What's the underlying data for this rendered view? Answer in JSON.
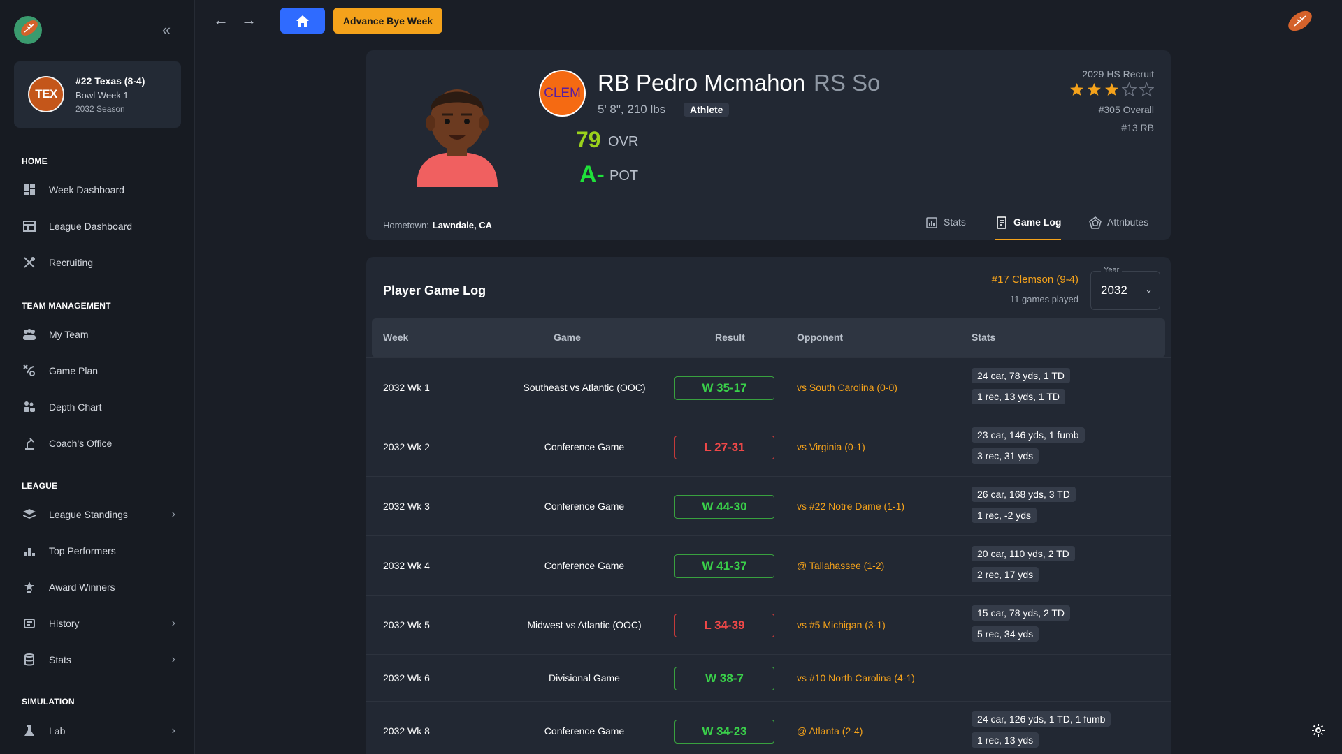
{
  "sidebar": {
    "team_card": {
      "badge": "TEX",
      "title": "#22 Texas (8-4)",
      "week": "Bowl Week 1",
      "season": "2032 Season"
    },
    "sections": {
      "home": "HOME",
      "team_management": "TEAM MANAGEMENT",
      "league": "LEAGUE",
      "simulation": "SIMULATION"
    },
    "items": [
      {
        "label": "Week Dashboard",
        "icon": "dashboard-icon"
      },
      {
        "label": "League Dashboard",
        "icon": "table-icon"
      },
      {
        "label": "Recruiting",
        "icon": "recruiting-icon"
      },
      {
        "label": "My Team",
        "icon": "team-icon"
      },
      {
        "label": "Game Plan",
        "icon": "game-plan-icon"
      },
      {
        "label": "Depth Chart",
        "icon": "depth-chart-icon"
      },
      {
        "label": "Coach's Office",
        "icon": "desk-lamp-icon"
      },
      {
        "label": "League Standings",
        "icon": "layers-icon"
      },
      {
        "label": "Top Performers",
        "icon": "podium-icon"
      },
      {
        "label": "Award Winners",
        "icon": "trophy-icon"
      },
      {
        "label": "History",
        "icon": "history-icon"
      },
      {
        "label": "Stats",
        "icon": "database-icon"
      },
      {
        "label": "Lab",
        "icon": "flask-icon"
      }
    ]
  },
  "topbar": {
    "advance_label": "Advance Bye Week"
  },
  "player": {
    "team_badge": "CLEM",
    "name": "RB Pedro Mcmahon",
    "class_year": "RS So",
    "body": "5' 8\", 210 lbs",
    "tag": "Athlete",
    "ovr": "79",
    "ovr_label": "OVR",
    "pot": "A-",
    "pot_label": "POT",
    "recruit_year": "2029 HS Recruit",
    "stars": 3,
    "stars_max": 5,
    "overall_rank": "#305 Overall",
    "position_rank": "#13 RB",
    "hometown_label": "Hometown:",
    "hometown": "Lawndale, CA",
    "tabs": [
      {
        "label": "Stats",
        "icon": "bar-chart-icon"
      },
      {
        "label": "Game Log",
        "icon": "document-icon",
        "active": true
      },
      {
        "label": "Attributes",
        "icon": "pentagon-icon"
      }
    ]
  },
  "game_log": {
    "title": "Player Game Log",
    "team": "#17 Clemson (9-4)",
    "games_played": "11 games played",
    "year_label": "Year",
    "year_value": "2032",
    "columns": [
      "Week",
      "Game",
      "Result",
      "Opponent",
      "Stats"
    ],
    "rows": [
      {
        "week": "2032 Wk 1",
        "game": "Southeast vs Atlantic (OOC)",
        "result": "W 35-17",
        "outcome": "win",
        "opponent": "vs South Carolina (0-0)",
        "stats": [
          "24 car, 78 yds, 1 TD",
          "1 rec, 13 yds, 1 TD"
        ]
      },
      {
        "week": "2032 Wk 2",
        "game": "Conference Game",
        "result": "L 27-31",
        "outcome": "loss",
        "opponent": "vs Virginia (0-1)",
        "stats": [
          "23 car, 146 yds, 1 fumb",
          "3 rec, 31 yds"
        ]
      },
      {
        "week": "2032 Wk 3",
        "game": "Conference Game",
        "result": "W 44-30",
        "outcome": "win",
        "opponent": "vs #22 Notre Dame (1-1)",
        "stats": [
          "26 car, 168 yds, 3 TD",
          "1 rec, -2 yds"
        ]
      },
      {
        "week": "2032 Wk 4",
        "game": "Conference Game",
        "result": "W 41-37",
        "outcome": "win",
        "opponent": "@ Tallahassee (1-2)",
        "stats": [
          "20 car, 110 yds, 2 TD",
          "2 rec, 17 yds"
        ]
      },
      {
        "week": "2032 Wk 5",
        "game": "Midwest vs Atlantic (OOC)",
        "result": "L 34-39",
        "outcome": "loss",
        "opponent": "vs #5 Michigan (3-1)",
        "stats": [
          "15 car, 78 yds, 2 TD",
          "5 rec, 34 yds"
        ]
      },
      {
        "week": "2032 Wk 6",
        "game": "Divisional Game",
        "result": "W 38-7",
        "outcome": "win",
        "opponent": "vs #10 North Carolina (4-1)",
        "stats": []
      },
      {
        "week": "2032 Wk 8",
        "game": "Conference Game",
        "result": "W 34-23",
        "outcome": "win",
        "opponent": "@ Atlanta (2-4)",
        "stats": [
          "24 car, 126 yds, 1 TD, 1 fumb",
          "1 rec, 13 yds"
        ]
      }
    ]
  },
  "colors": {
    "accent": "#f4a21b",
    "primary": "#2f6bff",
    "win": "#3ad14a",
    "loss": "#f04848",
    "ovr": "#9bd21c",
    "pot": "#1fe13a"
  }
}
